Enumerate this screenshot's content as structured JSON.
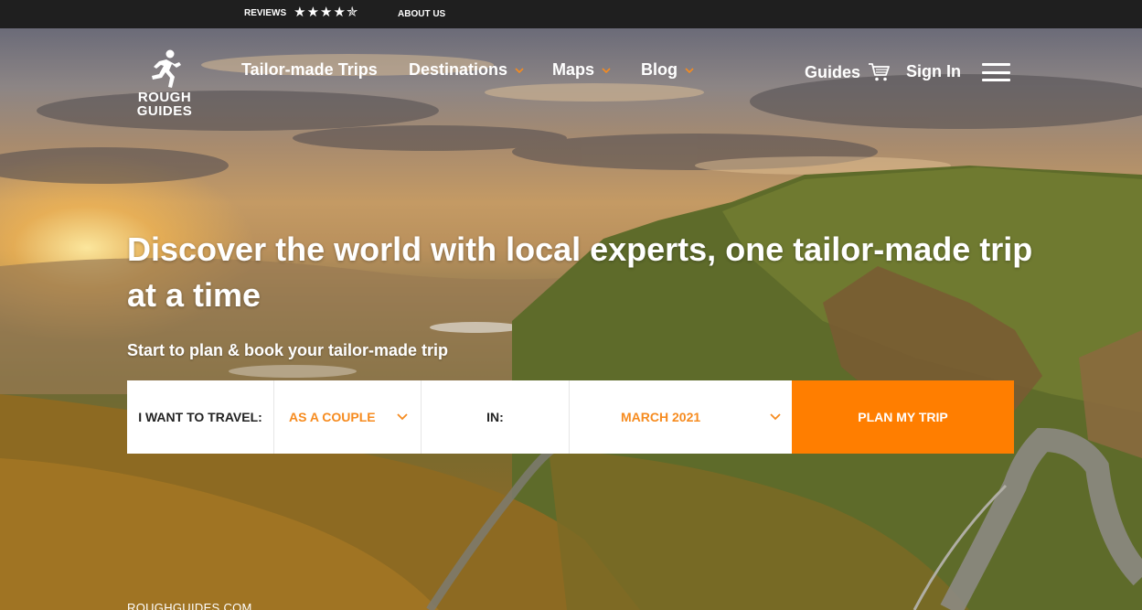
{
  "topbar": {
    "reviews_label": "REVIEWS",
    "stars": "★★★★✯",
    "about_label": "ABOUT US"
  },
  "logo": {
    "line1": "ROUGH",
    "line2": "GUIDES"
  },
  "nav": {
    "items": [
      {
        "label": "Tailor-made Trips"
      },
      {
        "label": "Destinations"
      },
      {
        "label": "Maps"
      },
      {
        "label": "Blog"
      }
    ],
    "guides_label": "Guides",
    "signin_label": "Sign In"
  },
  "hero": {
    "headline": "Discover the world with local experts, one tailor-made trip at a time",
    "subheadline": "Start to plan & book your tailor-made trip"
  },
  "planner": {
    "travel_label": "I WANT TO TRAVEL:",
    "travel_value": "AS A COUPLE",
    "in_label": "IN:",
    "month_value": "MARCH 2021",
    "cta_label": "PLAN MY TRIP"
  },
  "footer": {
    "site": "ROUGHGUIDES.COM"
  },
  "colors": {
    "accent": "#ff7e00",
    "accent_text": "#f68b1f",
    "topbar": "#1f1f1f"
  },
  "icons": [
    "runner-logo-icon",
    "chevron-down-icon",
    "cart-icon",
    "hamburger-menu-icon",
    "star-icon"
  ]
}
